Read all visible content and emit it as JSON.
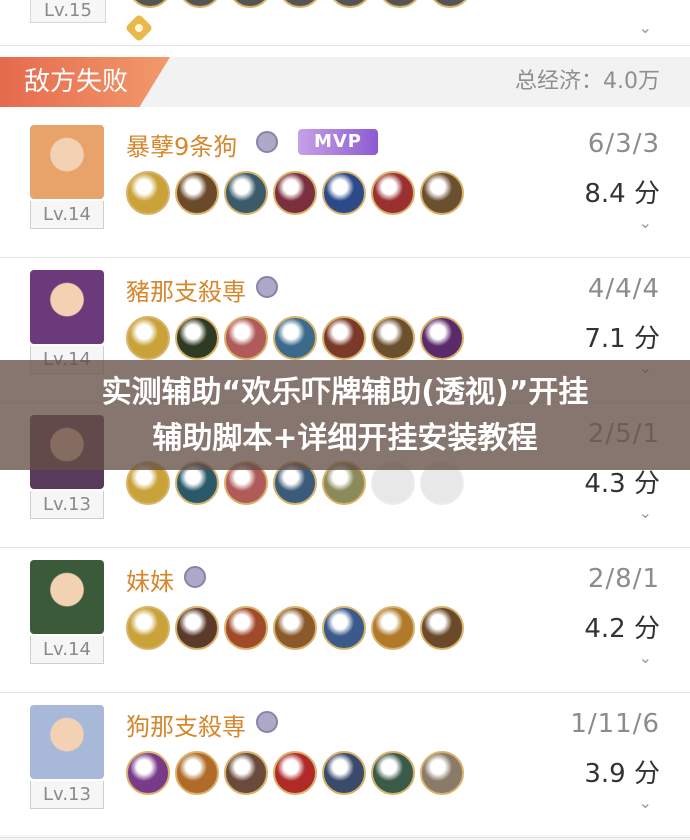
{
  "top": {
    "level": "Lv.15"
  },
  "section": {
    "title": "敌方失败",
    "economy": "总经济：4.0万"
  },
  "players": [
    {
      "name": "暴孽9条狗",
      "level": "Lv.14",
      "kda": "6/3/3",
      "score": "8.4 分",
      "mvp": "MVP",
      "avatar_color": "#e8a36a",
      "items": [
        "#c9a23a",
        "#6b4a2c",
        "#3b5b6a",
        "#7a2f3f",
        "#2a4a8a",
        "#9a3030",
        "#6b5030"
      ]
    },
    {
      "name": "豬那支殺専",
      "level": "Lv.14",
      "kda": "4/4/4",
      "score": "7.1 分",
      "avatar_color": "#6a3a7a",
      "items": [
        "#c9a23a",
        "#2f3a24",
        "#b05a5a",
        "#3b6a8a",
        "#7a3a2a",
        "#6b5030",
        "#5a2a6a"
      ]
    },
    {
      "name": "",
      "level": "Lv.13",
      "kda": "2/5/1",
      "score": "4.3 分",
      "avatar_color": "#5a3a5a",
      "items": [
        "#c9a23a",
        "#2a5a6a",
        "#b05a5a",
        "#3b5b7a",
        "#8a8a5a",
        "empty",
        "empty"
      ]
    },
    {
      "name": "妹妹",
      "level": "Lv.14",
      "kda": "2/8/1",
      "score": "4.2 分",
      "avatar_color": "#3a5a3a",
      "items": [
        "#c9a23a",
        "#5a3a2a",
        "#a04a2a",
        "#8a5a2a",
        "#3a5a8a",
        "#b07a2a",
        "#6a4a2a"
      ]
    },
    {
      "name": "狗那支殺専",
      "level": "Lv.13",
      "kda": "1/11/6",
      "score": "3.9 分",
      "avatar_color": "#a8b8d8",
      "items": [
        "#7a3a8a",
        "#b06a2a",
        "#6a4a3a",
        "#b02a2a",
        "#3a4a6a",
        "#3a5a4a",
        "#8a7a6a"
      ]
    }
  ],
  "banner": {
    "line1": "实测辅助“欢乐吓牌辅助(透视)”开挂",
    "line2": "辅助脚本+详细开挂安装教程"
  },
  "icons": {
    "expand": "chevron-down-icon",
    "rank": "rank-badge-icon"
  }
}
